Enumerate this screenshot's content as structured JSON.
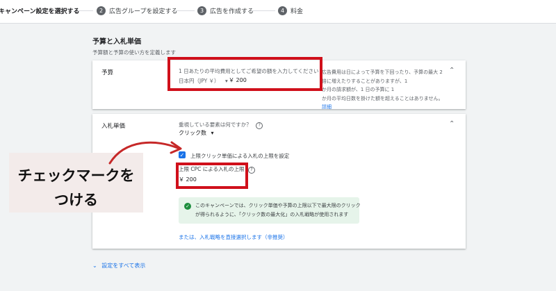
{
  "stepper": {
    "steps": [
      {
        "num": "",
        "label": "キャンペーン設定を選択する"
      },
      {
        "num": "2",
        "label": "広告グループを設定する"
      },
      {
        "num": "3",
        "label": "広告を作成する"
      },
      {
        "num": "4",
        "label": "料金"
      }
    ]
  },
  "section": {
    "title": "予算と入札単価",
    "subtitle": "予算額と予算の使い方を定義します"
  },
  "budget": {
    "label": "予算",
    "prompt": "1 日あたりの平均費用としてご希望の額を入力してください",
    "currency": "日本円（JPY ￥）",
    "amount": "￥ 200",
    "help_lines": [
      "広告費用は日によって予算を下回ったり、予算の最大 2",
      "倍に増えたりすることがありますが、1",
      "か月の請求額が、1 日の予算に 1",
      "か月の平均日数を掛けた額を超えることはありません。"
    ],
    "help_link": "詳細"
  },
  "bidding": {
    "label": "入札単価",
    "focus_question": "重視している要素は何ですか？",
    "focus_value": "クリック数",
    "checkbox_label": "上限クリック単価による入札の上限を設定",
    "cpc_label": "上限 CPC による入札の上限",
    "cpc_value": "￥ 200",
    "info_lines": [
      "このキャンペーンでは、クリック単価や予算の上限以下で最大限のクリック",
      "が得られるように、「クリック数の最大化」の入札戦略が使用されます"
    ],
    "strategy_link": "または、入札戦略を直接選択します（非推奨）"
  },
  "annotation": {
    "line1": "チェックマークを",
    "line2": "つける"
  },
  "footer": {
    "show_all": "設定をすべて表示"
  },
  "colors": {
    "highlight_red": "#d0101b",
    "link_blue": "#1a73e8",
    "success_green": "#1e8e3e",
    "arrow_red": "#c62828"
  }
}
